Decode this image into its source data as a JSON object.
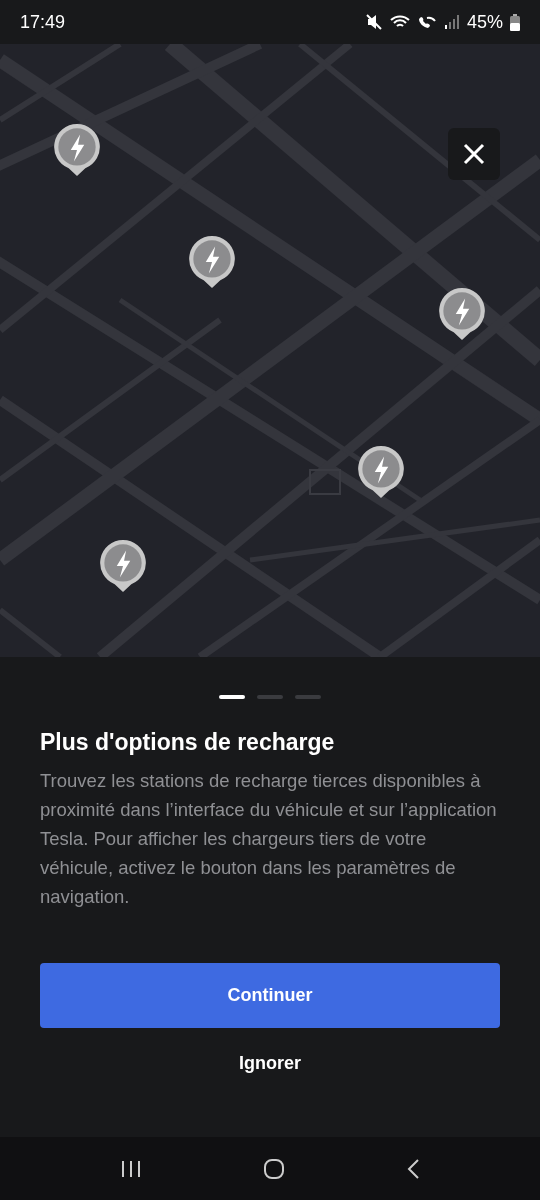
{
  "status_bar": {
    "time": "17:49",
    "battery": "45%"
  },
  "pager": [
    {
      "selected": true
    },
    {
      "selected": false
    },
    {
      "selected": false
    }
  ],
  "title": "Plus d'options de recharge",
  "body": "Trouvez les stations de recharge tierces disponibles à proximité dans l’interface du véhicule et sur l’application Tesla. Pour afficher les chargeurs tiers de votre véhicule, activez le bouton dans les paramètres de navigation.",
  "buttons": [
    {
      "kind": "primary",
      "label": "Continuer"
    },
    {
      "kind": "text",
      "label": "Ignorer"
    }
  ]
}
